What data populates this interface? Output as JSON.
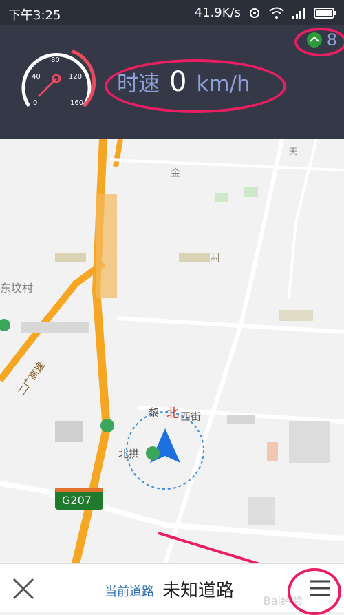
{
  "status_bar": {
    "time": "下午3:25",
    "network_speed": "41.9K/s"
  },
  "header": {
    "speed_label": "时速",
    "speed_value": "0",
    "speed_unit": "km/h",
    "satellite_count": "8",
    "speedometer_ticks": [
      "0",
      "40",
      "80",
      "120",
      "160"
    ]
  },
  "map": {
    "labels": [
      "金",
      "天",
      "东坟村",
      "村",
      "二广高速",
      "黎",
      "北",
      "西街",
      "北拱",
      "G207"
    ]
  },
  "bottom_bar": {
    "current_road_label": "当前道路",
    "current_road_name": "未知道路",
    "watermark": "Bai经验"
  },
  "colors": {
    "header_bg": "#353846",
    "status_bg": "#2b2f3a",
    "accent_blue": "#2d6fb8",
    "highlight": "#e91e63",
    "road_orange": "#f5a623",
    "highway_sign": "#1f7a2e"
  }
}
